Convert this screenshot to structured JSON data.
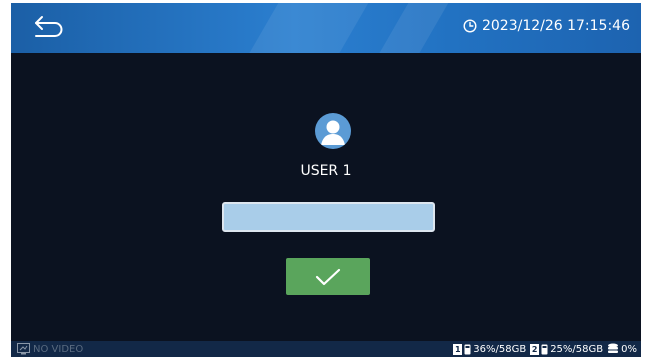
{
  "header": {
    "back_icon": "back-arrow-icon",
    "clock_icon": "clock-icon",
    "datetime": "2023/12/26 17:15:46"
  },
  "login": {
    "avatar_icon": "user-avatar-icon",
    "username": "USER 1",
    "password_value": "",
    "confirm_icon": "checkmark-icon"
  },
  "status": {
    "video_icon": "no-video-icon",
    "video_text": "NO VIDEO",
    "disks": [
      {
        "num": "1",
        "usage": "36%/58GB"
      },
      {
        "num": "2",
        "usage": "25%/58GB"
      }
    ],
    "storage_icon": "storage-icon",
    "storage_usage": "0%"
  },
  "colors": {
    "topbar": "#2272c2",
    "background": "#0b1220",
    "input_fill": "#a9cde9",
    "confirm": "#5aa55c",
    "statusbar": "#122847"
  }
}
